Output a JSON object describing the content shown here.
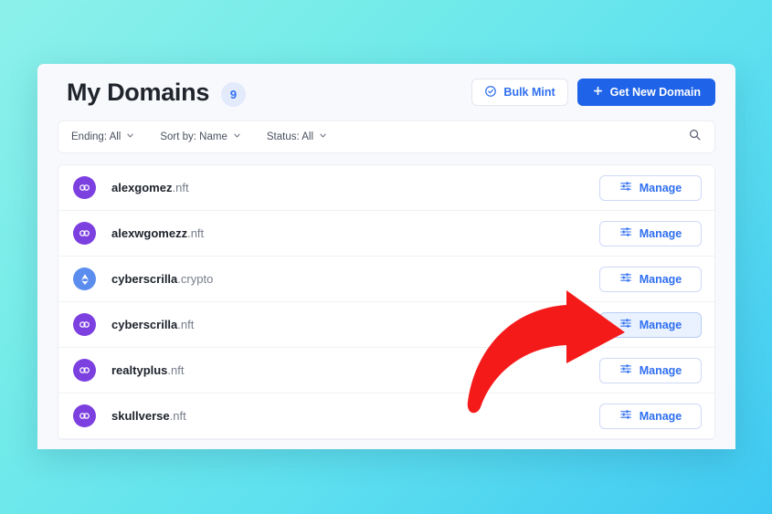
{
  "header": {
    "title": "My Domains",
    "count_badge": "9",
    "bulk_mint_label": "Bulk Mint",
    "bulk_mint_icon": "check-circle-icon",
    "get_new_domain_label": "Get New Domain",
    "get_new_domain_icon": "plus-icon"
  },
  "filters": {
    "search_icon": "search-icon",
    "dropdowns": [
      {
        "label": "Ending: All",
        "icon": "chevron-down-icon"
      },
      {
        "label": "Sort by: Name",
        "icon": "chevron-down-icon"
      },
      {
        "label": "Status: All",
        "icon": "chevron-down-icon"
      }
    ]
  },
  "domains": {
    "manage_label": "Manage",
    "manage_icon": "sliders-icon",
    "rows": [
      {
        "name": "alexgomez",
        "tld": ".nft",
        "icon": "nft-infinity-icon",
        "highlighted": false
      },
      {
        "name": "alexwgomezz",
        "tld": ".nft",
        "icon": "nft-infinity-icon",
        "highlighted": false
      },
      {
        "name": "cyberscrilla",
        "tld": ".crypto",
        "icon": "ethereum-diamond-icon",
        "highlighted": false
      },
      {
        "name": "cyberscrilla",
        "tld": ".nft",
        "icon": "nft-infinity-icon",
        "highlighted": true
      },
      {
        "name": "realtyplus",
        "tld": ".nft",
        "icon": "nft-infinity-icon",
        "highlighted": false
      },
      {
        "name": "skullverse",
        "tld": ".nft",
        "icon": "nft-infinity-icon",
        "highlighted": false
      }
    ]
  },
  "annotation": {
    "name": "red-curved-arrow",
    "color": "#f51a1a",
    "points_at": "manage-button-row-4"
  },
  "colors": {
    "accent_blue": "#1f63e8",
    "link_blue": "#2f6ff0",
    "nft_purple": "#7c3fe0",
    "crypto_blue": "#5b8def",
    "arrow_red": "#f51a1a",
    "card_bg": "#f8f9fc",
    "page_gradient_from": "#8df0ea",
    "page_gradient_to": "#3fc8f2"
  }
}
